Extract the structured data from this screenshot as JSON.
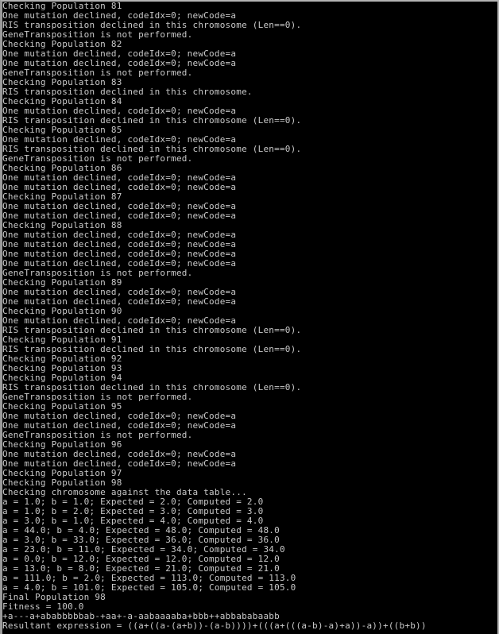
{
  "window": {
    "kind": "terminal-console",
    "title": "",
    "background_color": "#000000",
    "text_color": "#c8c8c8",
    "border_color": "#b4b4b4"
  },
  "console": {
    "lines": [
      "Checking Population 81",
      "One mutation declined, codeIdx=0; newCode=a",
      "RIS transposition declined in this chromosome (Len==0).",
      "GeneTransposition is not performed.",
      "Checking Population 82",
      "One mutation declined, codeIdx=0; newCode=a",
      "One mutation declined, codeIdx=0; newCode=a",
      "GeneTransposition is not performed.",
      "Checking Population 83",
      "RIS transposition declined in this chromosome.",
      "Checking Population 84",
      "One mutation declined, codeIdx=0; newCode=a",
      "RIS transposition declined in this chromosome (Len==0).",
      "Checking Population 85",
      "One mutation declined, codeIdx=0; newCode=a",
      "RIS transposition declined in this chromosome (Len==0).",
      "GeneTransposition is not performed.",
      "Checking Population 86",
      "One mutation declined, codeIdx=0; newCode=a",
      "One mutation declined, codeIdx=0; newCode=a",
      "Checking Population 87",
      "One mutation declined, codeIdx=0; newCode=a",
      "One mutation declined, codeIdx=0; newCode=a",
      "Checking Population 88",
      "One mutation declined, codeIdx=0; newCode=a",
      "One mutation declined, codeIdx=0; newCode=a",
      "One mutation declined, codeIdx=0; newCode=a",
      "One mutation declined, codeIdx=0; newCode=a",
      "GeneTransposition is not performed.",
      "Checking Population 89",
      "One mutation declined, codeIdx=0; newCode=a",
      "One mutation declined, codeIdx=0; newCode=a",
      "Checking Population 90",
      "One mutation declined, codeIdx=0; newCode=a",
      "RIS transposition declined in this chromosome (Len==0).",
      "Checking Population 91",
      "RIS transposition declined in this chromosome (Len==0).",
      "Checking Population 92",
      "Checking Population 93",
      "Checking Population 94",
      "RIS transposition declined in this chromosome (Len==0).",
      "GeneTransposition is not performed.",
      "Checking Population 95",
      "One mutation declined, codeIdx=0; newCode=a",
      "One mutation declined, codeIdx=0; newCode=a",
      "GeneTransposition is not performed.",
      "Checking Population 96",
      "One mutation declined, codeIdx=0; newCode=a",
      "One mutation declined, codeIdx=0; newCode=a",
      "Checking Population 97",
      "Checking Population 98",
      "Checking chromosome against the data table...",
      "a = 1.0; b = 1.0; Expected = 2.0; Computed = 2.0",
      "a = 1.0; b = 2.0; Expected = 3.0; Computed = 3.0",
      "a = 3.0; b = 1.0; Expected = 4.0; Computed = 4.0",
      "a = 44.0; b = 4.0; Expected = 48.0; Computed = 48.0",
      "a = 3.0; b = 33.0; Expected = 36.0; Computed = 36.0",
      "a = 23.0; b = 11.0; Expected = 34.0; Computed = 34.0",
      "a = 0.0; b = 12.0; Expected = 12.0; Computed = 12.0",
      "a = 13.0; b = 8.0; Expected = 21.0; Computed = 21.0",
      "a = 111.0; b = 2.0; Expected = 113.0; Computed = 113.0",
      "a = 4.0; b = 101.0; Expected = 105.0; Computed = 105.0",
      "Final Population 98",
      "Fitness = 100.0",
      "+a---a+ababbbbbab-+aa+-a-aabaaaaba+bbb++abbababaabb",
      "Resultant expression = ((a+((a-(a+b))-(a-b))))+(((a+(((a-b)-a)+a))-a))+((b+b))"
    ],
    "data_table": {
      "type": "table",
      "columns": [
        "a",
        "b",
        "Expected",
        "Computed"
      ],
      "rows": [
        [
          1.0,
          1.0,
          2.0,
          2.0
        ],
        [
          1.0,
          2.0,
          3.0,
          3.0
        ],
        [
          3.0,
          1.0,
          4.0,
          4.0
        ],
        [
          44.0,
          4.0,
          48.0,
          48.0
        ],
        [
          3.0,
          33.0,
          36.0,
          36.0
        ],
        [
          23.0,
          11.0,
          34.0,
          34.0
        ],
        [
          0.0,
          12.0,
          12.0,
          12.0
        ],
        [
          13.0,
          8.0,
          21.0,
          21.0
        ],
        [
          111.0,
          2.0,
          113.0,
          113.0
        ],
        [
          4.0,
          101.0,
          105.0,
          105.0
        ]
      ]
    },
    "summary": {
      "final_population": "Final Population 98",
      "fitness": "Fitness = 100.0",
      "chromosome": "+a---a+ababbbbbab-+aa+-a-aabaaaaba+bbb++abbababaabb",
      "resultant_expression": "Resultant expression = ((a+((a-(a+b))-(a-b))))+(((a+(((a-b)-a)+a))-a))+((b+b))"
    }
  }
}
